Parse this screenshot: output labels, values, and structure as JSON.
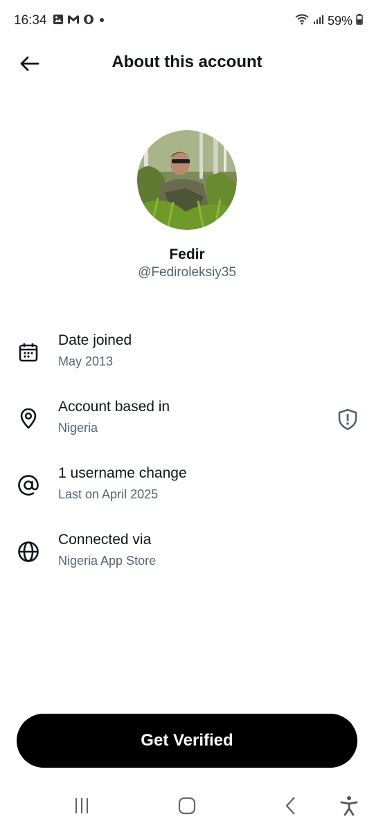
{
  "status_bar": {
    "time": "16:34",
    "battery_percent": "59%",
    "left_icons": [
      "image-icon",
      "gmail-icon",
      "opera-icon",
      "dot-icon"
    ],
    "right_icons": [
      "wifi-icon",
      "signal-icon",
      "battery-icon"
    ]
  },
  "header": {
    "title": "About this account",
    "back_icon": "arrow-left-icon"
  },
  "profile": {
    "display_name": "Fedir",
    "handle": "@Fediroleksiy35"
  },
  "info_rows": [
    {
      "icon": "calendar-icon",
      "title": "Date joined",
      "subtitle": "May 2013"
    },
    {
      "icon": "location-pin-icon",
      "title": "Account based in",
      "subtitle": "Nigeria",
      "trailing_icon": "shield-alert-icon"
    },
    {
      "icon": "at-sign-icon",
      "title": "1 username change",
      "subtitle": "Last on April 2025"
    },
    {
      "icon": "globe-icon",
      "title": "Connected via",
      "subtitle": "Nigeria App Store"
    }
  ],
  "cta": {
    "label": "Get Verified"
  },
  "nav_bar": {
    "items": [
      "recents-icon",
      "home-icon",
      "back-icon",
      "accessibility-icon"
    ]
  },
  "colors": {
    "primary_text": "#0f1419",
    "secondary_text": "#536471",
    "cta_background": "#000000",
    "cta_text": "#ffffff"
  }
}
